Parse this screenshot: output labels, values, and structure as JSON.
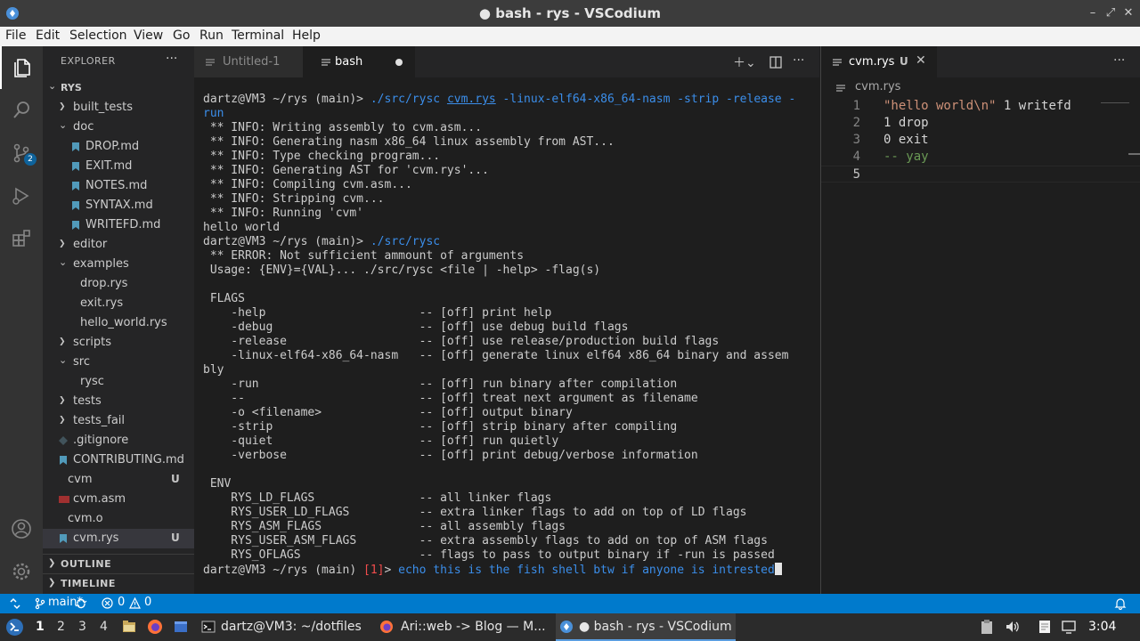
{
  "window": {
    "title": "● bash - rys - VSCodium"
  },
  "menu": [
    "File",
    "Edit",
    "Selection",
    "View",
    "Go",
    "Run",
    "Terminal",
    "Help"
  ],
  "activity": {
    "items": [
      "explorer-icon",
      "search-icon",
      "source-control-icon",
      "run-debug-icon",
      "extensions-icon",
      "account-icon",
      "settings-gear-icon"
    ],
    "scm_badge": "2"
  },
  "sidebar": {
    "header": "EXPLORER",
    "more": "···",
    "root": "RYS",
    "tree": [
      {
        "label": "built_tests",
        "kind": "folder",
        "open": false,
        "depth": 1
      },
      {
        "label": "doc",
        "kind": "folder",
        "open": true,
        "depth": 1
      },
      {
        "label": "DROP.md",
        "kind": "md",
        "depth": 2
      },
      {
        "label": "EXIT.md",
        "kind": "md",
        "depth": 2
      },
      {
        "label": "NOTES.md",
        "kind": "md",
        "depth": 2
      },
      {
        "label": "SYNTAX.md",
        "kind": "md",
        "depth": 2
      },
      {
        "label": "WRITEFD.md",
        "kind": "md",
        "depth": 2
      },
      {
        "label": "editor",
        "kind": "folder",
        "open": false,
        "depth": 1
      },
      {
        "label": "examples",
        "kind": "folder",
        "open": true,
        "depth": 1
      },
      {
        "label": "drop.rys",
        "kind": "file",
        "depth": 2
      },
      {
        "label": "exit.rys",
        "kind": "file",
        "depth": 2
      },
      {
        "label": "hello_world.rys",
        "kind": "file",
        "depth": 2
      },
      {
        "label": "scripts",
        "kind": "folder",
        "open": false,
        "depth": 1
      },
      {
        "label": "src",
        "kind": "folder",
        "open": true,
        "depth": 1
      },
      {
        "label": "rysc",
        "kind": "file",
        "depth": 2
      },
      {
        "label": "tests",
        "kind": "folder",
        "open": false,
        "depth": 1
      },
      {
        "label": "tests_fail",
        "kind": "folder",
        "open": false,
        "depth": 1
      },
      {
        "label": ".gitignore",
        "kind": "git",
        "depth": 1
      },
      {
        "label": "CONTRIBUTING.md",
        "kind": "md",
        "depth": 1
      },
      {
        "label": "cvm",
        "kind": "file",
        "depth": 1,
        "status": "U"
      },
      {
        "label": "cvm.asm",
        "kind": "asm",
        "depth": 1
      },
      {
        "label": "cvm.o",
        "kind": "file",
        "depth": 1
      },
      {
        "label": "cvm.rys",
        "kind": "rys",
        "depth": 1,
        "status": "U",
        "selected": true
      }
    ],
    "outline": "OUTLINE",
    "timeline": "TIMELINE"
  },
  "group1": {
    "tabs": [
      {
        "label": "Untitled-1",
        "active": false
      },
      {
        "label": "bash",
        "active": true,
        "dirty": true
      }
    ]
  },
  "terminal": {
    "lines": [
      [
        {
          "t": "dartz@VM3 ~/rys (main)> ",
          "c": "c-grn"
        },
        {
          "t": "./src/rysc ",
          "c": "c-blue"
        },
        {
          "t": "cvm.rys",
          "c": "c-blue u"
        },
        {
          "t": " -linux-elf64-x86_64-nasm -strip -release -",
          "c": "c-blue"
        }
      ],
      [
        {
          "t": "run",
          "c": "c-blue"
        }
      ],
      [
        {
          "t": " ** INFO: Writing assembly to cvm.asm..."
        }
      ],
      [
        {
          "t": " ** INFO: Generating nasm x86_64 linux assembly from AST..."
        }
      ],
      [
        {
          "t": " ** INFO: Type checking program..."
        }
      ],
      [
        {
          "t": " ** INFO: Generating AST for 'cvm.rys'..."
        }
      ],
      [
        {
          "t": " ** INFO: Compiling cvm.asm..."
        }
      ],
      [
        {
          "t": " ** INFO: Stripping cvm..."
        }
      ],
      [
        {
          "t": " ** INFO: Running 'cvm'"
        }
      ],
      [
        {
          "t": "hello world"
        }
      ],
      [
        {
          "t": "dartz@VM3 ~/rys (main)> ",
          "c": "c-grn"
        },
        {
          "t": "./src/rysc",
          "c": "c-blue"
        }
      ],
      [
        {
          "t": " ** ERROR: Not sufficient ammount of arguments"
        }
      ],
      [
        {
          "t": " Usage: {ENV}={VAL}... ./src/rysc <file | -help> -flag(s)"
        }
      ],
      [
        {
          "t": ""
        }
      ],
      [
        {
          "t": " FLAGS"
        }
      ],
      [
        {
          "t": "    -help                      -- [off] print help"
        }
      ],
      [
        {
          "t": "    -debug                     -- [off] use debug build flags"
        }
      ],
      [
        {
          "t": "    -release                   -- [off] use release/production build flags"
        }
      ],
      [
        {
          "t": "    -linux-elf64-x86_64-nasm   -- [off] generate linux elf64 x86_64 binary and assem"
        }
      ],
      [
        {
          "t": "bly"
        }
      ],
      [
        {
          "t": "    -run                       -- [off] run binary after compilation"
        }
      ],
      [
        {
          "t": "    --                         -- [off] treat next argument as filename"
        }
      ],
      [
        {
          "t": "    -o <filename>              -- [off] output binary"
        }
      ],
      [
        {
          "t": "    -strip                     -- [off] strip binary after compiling"
        }
      ],
      [
        {
          "t": "    -quiet                     -- [off] run quietly"
        }
      ],
      [
        {
          "t": "    -verbose                   -- [off] print debug/verbose information"
        }
      ],
      [
        {
          "t": ""
        }
      ],
      [
        {
          "t": " ENV"
        }
      ],
      [
        {
          "t": "    RYS_LD_FLAGS               -- all linker flags"
        }
      ],
      [
        {
          "t": "    RYS_USER_LD_FLAGS          -- extra linker flags to add on top of LD flags"
        }
      ],
      [
        {
          "t": "    RYS_ASM_FLAGS              -- all assembly flags"
        }
      ],
      [
        {
          "t": "    RYS_USER_ASM_FLAGS         -- extra assembly flags to add on top of ASM flags"
        }
      ],
      [
        {
          "t": "    RYS_OFLAGS                 -- flags to pass to output binary if -run is passed"
        }
      ],
      [
        {
          "t": "dartz@VM3 ~/rys (main) ",
          "c": "c-grn"
        },
        {
          "t": "[1]",
          "c": "c-red"
        },
        {
          "t": "> ",
          "c": "c-grn"
        },
        {
          "t": "echo this is the fish shell btw if anyone is intrested",
          "c": "c-blue"
        },
        {
          "t": "",
          "cursor": true
        }
      ]
    ]
  },
  "group2": {
    "tab_label": "cvm.rys",
    "tab_status": "U",
    "breadcrumb": "cvm.rys",
    "code": [
      {
        "n": "1",
        "parts": [
          {
            "t": "\"hello world\\n\"",
            "c": "s-str"
          },
          {
            "t": " 1 writefd"
          }
        ]
      },
      {
        "n": "2",
        "parts": [
          {
            "t": "1 drop"
          }
        ]
      },
      {
        "n": "3",
        "parts": [
          {
            "t": "0 exit"
          }
        ]
      },
      {
        "n": "4",
        "parts": [
          {
            "t": "-- yay",
            "c": "s-cmt"
          }
        ]
      },
      {
        "n": "5",
        "parts": [
          {
            "t": ""
          }
        ],
        "current": true
      }
    ]
  },
  "statusbar": {
    "branch": "main*",
    "errors": "0",
    "warnings": "0"
  },
  "taskbar": {
    "workspaces": [
      "1",
      "2",
      "3",
      "4"
    ],
    "tasks": [
      {
        "label": "dartz@VM3: ~/dotfiles",
        "icon": "terminal-icon"
      },
      {
        "label": "Ari::web -> Blog — M...",
        "icon": "firefox-icon"
      },
      {
        "label": "● bash - rys - VSCodium",
        "icon": "vscodium-icon",
        "active": true
      }
    ],
    "clock": "3:04"
  },
  "colors": {
    "accent": "#007acc",
    "terminal_blue": "#3b8eea",
    "terminal_red": "#f14c4c",
    "string": "#ce9178",
    "comment": "#6a9955"
  }
}
